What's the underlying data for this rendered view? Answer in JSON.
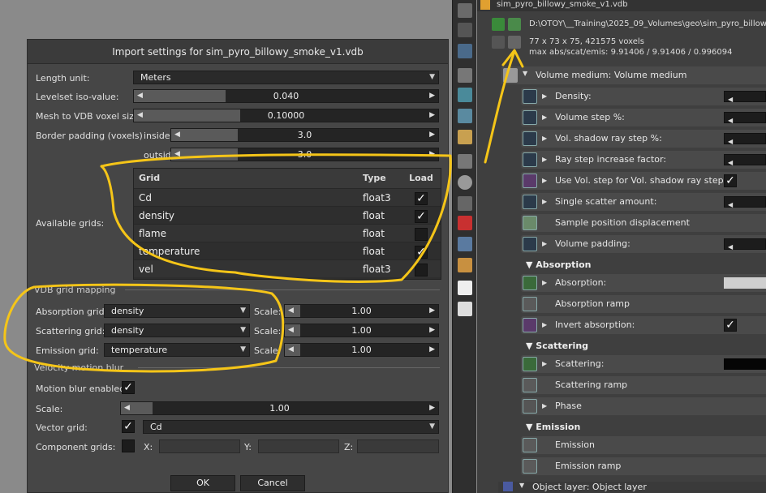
{
  "dialog": {
    "title": "Import settings for sim_pyro_billowy_smoke_v1.vdb",
    "length_unit_label": "Length unit:",
    "length_unit_value": "Meters",
    "levelset_label": "Levelset iso-value:",
    "levelset_value": "0.040",
    "mesh_voxel_label": "Mesh to VDB voxel size:",
    "mesh_voxel_value": "0.10000",
    "border_padding_label": "Border padding (voxels)",
    "inside_label": "inside:",
    "inside_value": "3.0",
    "outside_label": "outside:",
    "outside_value": "3.0",
    "available_grids_label": "Available grids:",
    "grid_headers": {
      "grid": "Grid",
      "type": "Type",
      "load": "Load"
    },
    "grids": [
      {
        "name": "Cd",
        "type": "float3",
        "load": true
      },
      {
        "name": "density",
        "type": "float",
        "load": true
      },
      {
        "name": "flame",
        "type": "float",
        "load": false
      },
      {
        "name": "temperature",
        "type": "float",
        "load": true
      },
      {
        "name": "vel",
        "type": "float3",
        "load": false
      }
    ],
    "vdb_mapping_label": "VDB grid mapping",
    "absorption_grid_label": "Absorption grid:",
    "absorption_grid_value": "density",
    "scattering_grid_label": "Scattering grid:",
    "scattering_grid_value": "density",
    "emission_grid_label": "Emission grid:",
    "emission_grid_value": "temperature",
    "scale_label": "Scale:",
    "absorption_scale": "1.00",
    "scattering_scale": "1.00",
    "emission_scale": "1.00",
    "velocity_label": "Velocity motion blur",
    "motion_blur_label": "Motion blur enabled:",
    "vel_scale_label": "Scale:",
    "vel_scale_value": "1.00",
    "vector_grid_label": "Vector grid:",
    "vector_grid_value": "Cd",
    "component_grids_label": "Component grids:",
    "x_label": "X:",
    "y_label": "Y:",
    "z_label": "Z:",
    "ok_label": "OK",
    "cancel_label": "Cancel"
  },
  "panel": {
    "file_name": "sim_pyro_billowy_smoke_v1.vdb",
    "path": "D:\\OTOY\\__Training\\2025_09_Volumes\\geo\\sim_pyro_billow",
    "voxels": "77 x 73 x 75, 421575 voxels",
    "max_values": "max abs/scat/emis: 9.91406 / 9.91406 / 0.996094",
    "volume_medium": "Volume medium: Volume medium",
    "rows": [
      "Density:",
      "Volume step %:",
      "Vol. shadow ray step %:",
      "Ray step increase factor:",
      "Use Vol. step for Vol. shadow ray step:",
      "Single scatter amount:",
      "Sample position displacement",
      "Volume padding:"
    ],
    "absorption_header": "Absorption",
    "absorption_rows": [
      "Absorption:",
      "Absorption ramp",
      "Invert absorption:"
    ],
    "scattering_header": "Scattering",
    "scattering_rows": [
      "Scattering:",
      "Scattering ramp",
      "Phase"
    ],
    "emission_header": "Emission",
    "emission_rows": [
      "Emission",
      "Emission ramp"
    ],
    "object_layer": "Object layer: Object layer"
  },
  "colors": {
    "annotation": "#f5c518"
  }
}
